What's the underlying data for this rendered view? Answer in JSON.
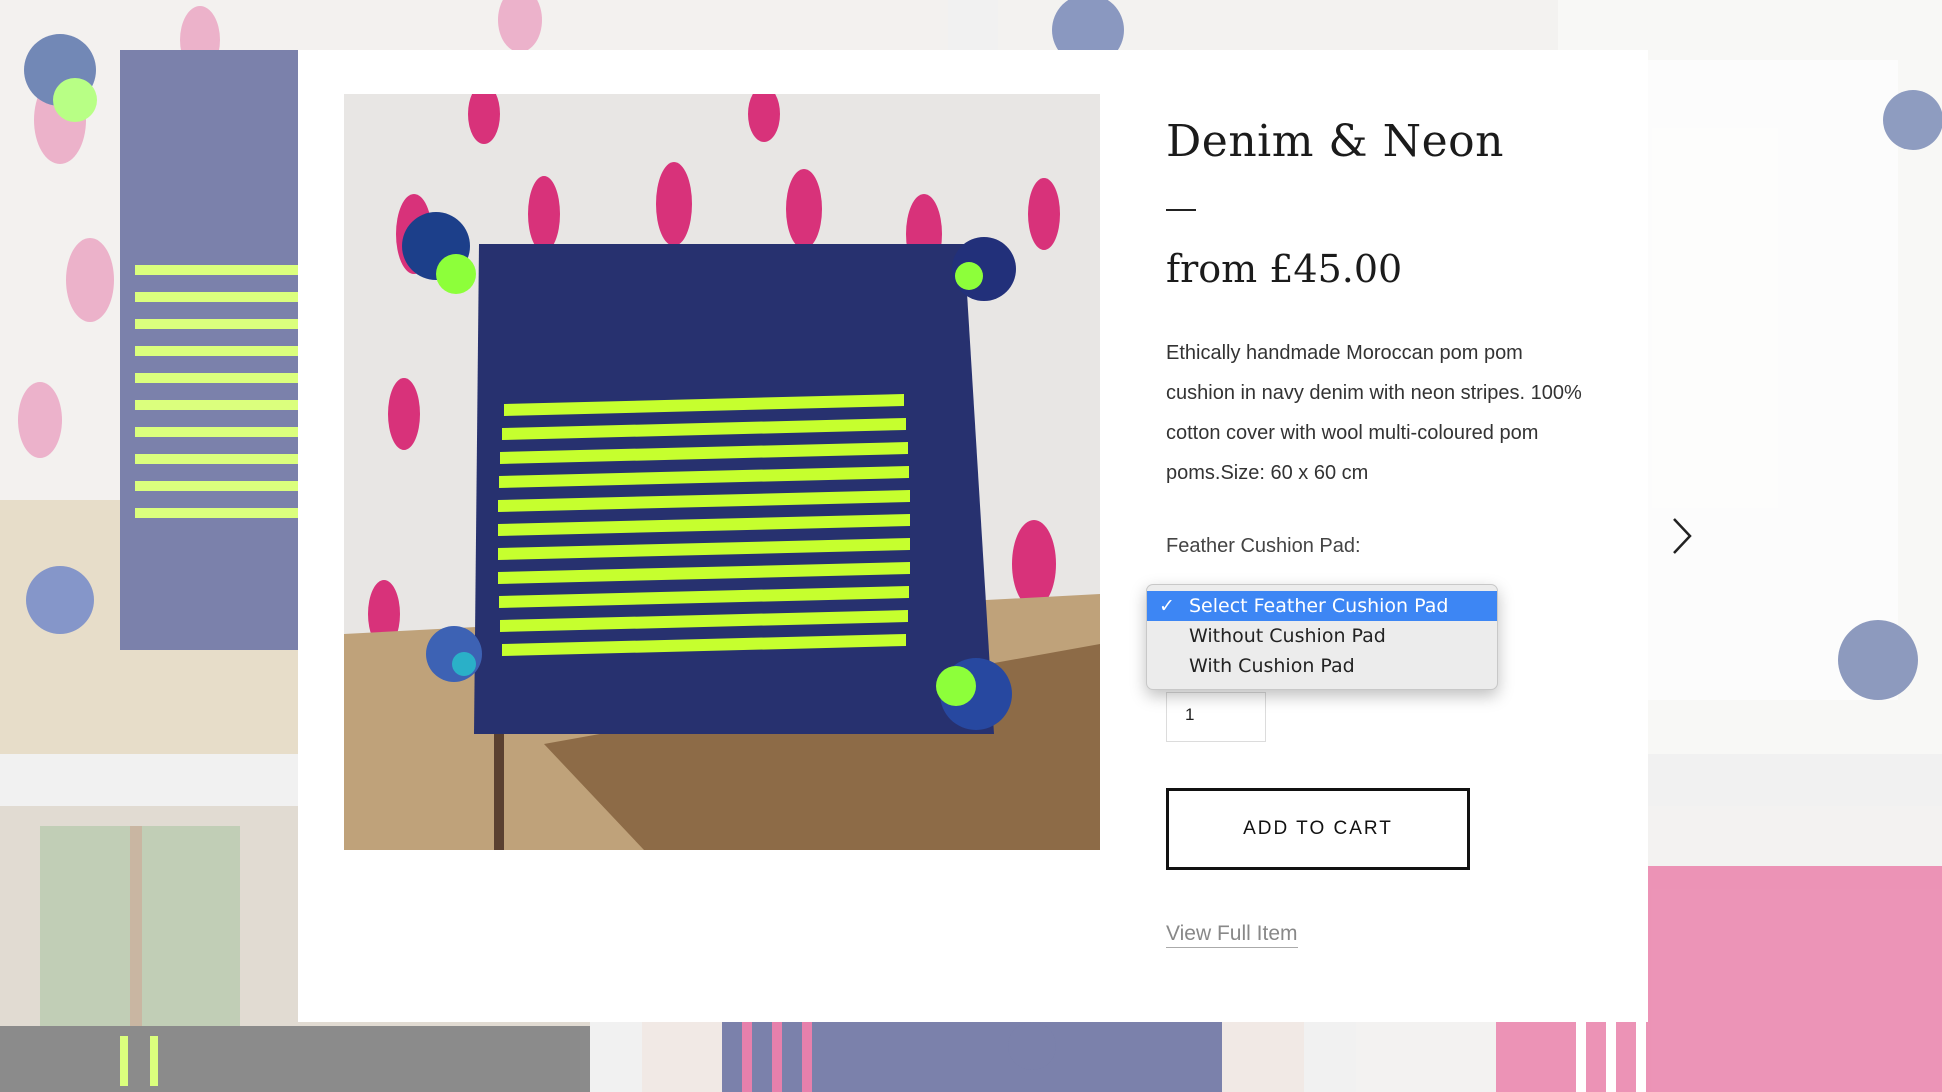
{
  "product": {
    "title": "Denim & Neon",
    "price": "from £45.00",
    "description": "Ethically handmade Moroccan pom pom cushion in navy denim with neon stripes. 100% cotton cover with wool multi-coloured pom poms.Size: 60 x 60 cm"
  },
  "options": {
    "label": "Feather Cushion Pad:",
    "items": [
      {
        "label": "Select Feather Cushion Pad",
        "selected": true
      },
      {
        "label": "Without Cushion Pad",
        "selected": false
      },
      {
        "label": "With Cushion Pad",
        "selected": false
      }
    ],
    "check_mark": "✓"
  },
  "quantity": {
    "value": "1"
  },
  "actions": {
    "add_to_cart": "ADD TO CART",
    "view_full_item": "View Full Item"
  },
  "icons": {
    "next": "chevron-right-icon"
  },
  "colors": {
    "navy": "#1f2a6b",
    "neon": "#c6ff2e",
    "pink": "#d8327a",
    "highlight": "#3d86f4"
  }
}
